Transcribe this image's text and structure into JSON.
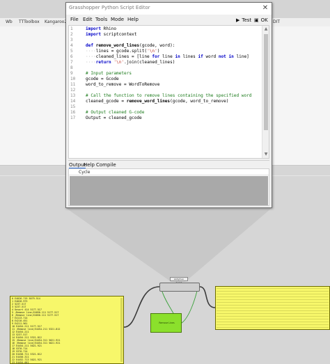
{
  "background": {
    "menu_items": [
      "Wb",
      "TTToolbox",
      "Kangaroo2"
    ],
    "trailing_menu": "DIT"
  },
  "window": {
    "title": "Grasshopper Python Script Editor",
    "close_glyph": "✕",
    "menu": [
      "File",
      "Edit",
      "Tools",
      "Mode",
      "Help"
    ],
    "test_label": "Test",
    "ok_label": "OK"
  },
  "editor": {
    "lines": [
      {
        "n": "1",
        "parts": [
          {
            "t": "k",
            "v": "import"
          },
          {
            "t": "p",
            "v": " Rhino"
          }
        ]
      },
      {
        "n": "2",
        "parts": [
          {
            "t": "k",
            "v": "import"
          },
          {
            "t": "p",
            "v": " scriptcontext"
          }
        ]
      },
      {
        "n": "3",
        "parts": []
      },
      {
        "n": "4",
        "parts": [
          {
            "t": "k",
            "v": "def"
          },
          {
            "t": "p",
            "v": " "
          },
          {
            "t": "fn",
            "v": "remove_word_lines"
          },
          {
            "t": "p",
            "v": "(gcode, word):"
          }
        ]
      },
      {
        "n": "5",
        "parts": [
          {
            "t": "d",
            "v": "····"
          },
          {
            "t": "p",
            "v": "lines = gcode.split("
          },
          {
            "t": "s",
            "v": "'\\n'"
          },
          {
            "t": "p",
            "v": ")"
          }
        ]
      },
      {
        "n": "6",
        "parts": [
          {
            "t": "d",
            "v": "····"
          },
          {
            "t": "p",
            "v": "cleaned_lines = [line "
          },
          {
            "t": "k",
            "v": "for"
          },
          {
            "t": "p",
            "v": " line "
          },
          {
            "t": "k",
            "v": "in"
          },
          {
            "t": "p",
            "v": " lines "
          },
          {
            "t": "k",
            "v": "if"
          },
          {
            "t": "p",
            "v": " word "
          },
          {
            "t": "k",
            "v": "not in"
          },
          {
            "t": "p",
            "v": " line]"
          }
        ]
      },
      {
        "n": "7",
        "parts": [
          {
            "t": "d",
            "v": "····"
          },
          {
            "t": "k",
            "v": "return"
          },
          {
            "t": "p",
            "v": " "
          },
          {
            "t": "s",
            "v": "'\\n'"
          },
          {
            "t": "p",
            "v": ".join(cleaned_lines)"
          }
        ]
      },
      {
        "n": "8",
        "parts": []
      },
      {
        "n": "9",
        "parts": [
          {
            "t": "c",
            "v": "# Input parameters"
          }
        ]
      },
      {
        "n": "10",
        "parts": [
          {
            "t": "p",
            "v": "gcode = Gcode"
          }
        ]
      },
      {
        "n": "11",
        "parts": [
          {
            "t": "p",
            "v": "word_to_remove = WordToRemove"
          }
        ]
      },
      {
        "n": "12",
        "parts": []
      },
      {
        "n": "13",
        "parts": [
          {
            "t": "c",
            "v": "# Call the function to remove lines containing the specified word"
          }
        ]
      },
      {
        "n": "14",
        "parts": [
          {
            "t": "p",
            "v": "cleaned_gcode = "
          },
          {
            "t": "fn",
            "v": "remove_word_lines"
          },
          {
            "t": "p",
            "v": "(gcode, word_to_remove)"
          }
        ]
      },
      {
        "n": "15",
        "parts": []
      },
      {
        "n": "16",
        "parts": [
          {
            "t": "c",
            "v": "# Output cleaned G-code"
          }
        ]
      },
      {
        "n": "17",
        "parts": [
          {
            "t": "p",
            "v": "Output = cleaned_gcode"
          }
        ]
      }
    ]
  },
  "output": {
    "tabs": [
      "Output",
      "Help",
      "Compile"
    ],
    "column_header": "Cycle"
  },
  "canvas": {
    "component_label": "GhPython Script",
    "component_name": "Remove Lines",
    "panel_rows": [
      "0 E4026.719 5079.514",
      "1 E4028.973",
      "2 5237.517",
      "3 5237.517",
      "4 Unsort 414 5177.517",
      "5 ;Remove line;E4050.111 5177.517",
      "6 ;Remove line;E4050.111 5177.517",
      "7 E4113.714",
      "8 E4210.451",
      "9 E4211.961",
      "10 E4454.211 5177.517",
      "11 ;Remove line;E4454.211 5321.812",
      "12 E4454.211",
      "13 5237.517",
      "14 E4454.211 5321.812",
      "15 ;Remove line;E4454.311 5021.921",
      "16 ;Remove line;E4454.311 5021.921",
      "17 E4454.211 5021.921",
      "18 5370.714",
      "19 5370.714",
      "20 E4458.711 5321.812",
      "21 E4450.311",
      "22 E4452.713 5021.921",
      "23 E4454.061"
    ]
  },
  "colors": {
    "panel_yellow": "#f7f76a",
    "node_green": "#8be02c",
    "keyword_blue": "#0000c8",
    "comment_green": "#1a7a1a",
    "string_red": "#c0392b"
  }
}
